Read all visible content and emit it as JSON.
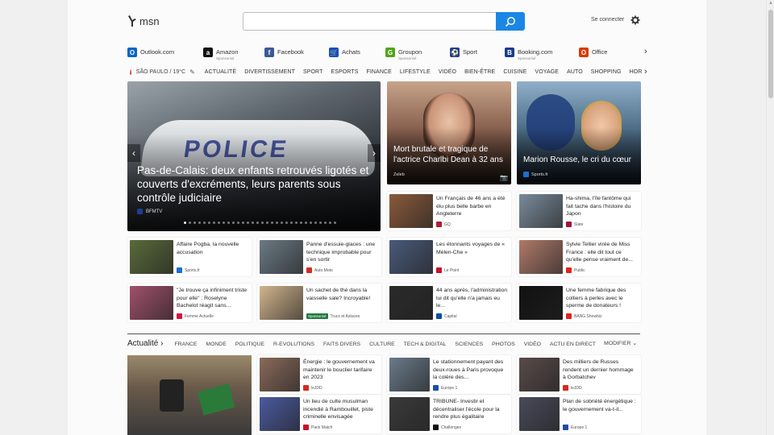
{
  "header": {
    "logo_text": "msn",
    "search_placeholder": "",
    "signin": "Se connecter"
  },
  "quick_links": [
    {
      "label": "Outlook.com",
      "sponsored": "",
      "color": "#0a64c8",
      "glyph": "O"
    },
    {
      "label": "Amazon",
      "sponsored": "Sponsorisé",
      "color": "#111111",
      "glyph": "a"
    },
    {
      "label": "Facebook",
      "sponsored": "",
      "color": "#3b5998",
      "glyph": "f"
    },
    {
      "label": "Achats",
      "sponsored": "",
      "color": "#1a4fb4",
      "glyph": "🛒"
    },
    {
      "label": "Groupon",
      "sponsored": "Sponsorisé",
      "color": "#53a318",
      "glyph": "G"
    },
    {
      "label": "Sport",
      "sponsored": "",
      "color": "#1f3f8f",
      "glyph": "⚽"
    },
    {
      "label": "Booking.com",
      "sponsored": "Sponsorisé",
      "color": "#1b3b8b",
      "glyph": "B"
    },
    {
      "label": "Office",
      "sponsored": "",
      "color": "#d83b01",
      "glyph": "O"
    }
  ],
  "navbar": {
    "alert": "!",
    "weather": "SÃO PAULO / 19°C",
    "categories": [
      "ACTUALITÉ",
      "DIVERTISSEMENT",
      "SPORT",
      "ESPORTS",
      "FINANCE",
      "LIFESTYLE",
      "VIDÉO",
      "BIEN-ÊTRE",
      "CUISINE",
      "VOYAGE",
      "AUTO",
      "SHOPPING",
      "HOROSCO"
    ]
  },
  "hero": {
    "title": "Pas-de-Calais: deux enfants retrouvés ligotés et couverts d'excréments, leurs parents sous contrôle judiciaire",
    "source": "BFMTV",
    "slide_count": 32,
    "active_slide": 0
  },
  "tiles": [
    {
      "title": "Mort brutale et tragique de l'actrice Charlbi Dean à 32 ans",
      "source": "Zeleb"
    },
    {
      "title": "Marion Rousse, le cri du cœur",
      "source": "Sports.fr"
    }
  ],
  "cards": [
    {
      "title": "Un Français de 46 ans a été élu plus belle barbe en Angleterre",
      "source": "GQ",
      "sponsored": "",
      "color": "#8a5a3a",
      "src_color": "#b01e2e"
    },
    {
      "title": "Ha-shima, l'île fantôme qui fait tache dans l'histoire du Japon",
      "source": "Slate",
      "sponsored": "",
      "color": "#7a8b9a",
      "src_color": "#a0143c"
    },
    {
      "title": "Affaire Pogba, la nouvelle accusation",
      "source": "Sports.fr",
      "sponsored": "",
      "color": "#5a6b3a",
      "src_color": "#1c6fd1"
    },
    {
      "title": "Panne d'essuie-glaces : une technique improbable pour s'en sortir",
      "source": "Auto Moto",
      "sponsored": "",
      "color": "#6b7a84",
      "src_color": "#d52b1e"
    },
    {
      "title": "Les étonnants voyages de « Mélen-Che »",
      "source": "Le Point",
      "sponsored": "",
      "color": "#4a5a7a",
      "src_color": "#c8102e"
    },
    {
      "title": "Sylvie Tellier virée de Miss France : elle dit tout ce qu'elle pense vraiment de...",
      "source": "Public",
      "sponsored": "",
      "color": "#b07a6a",
      "src_color": "#e2231a"
    },
    {
      "title": "\"Je trouve ça infiniment triste pour elle\" : Roselyne Bachelot réagit sans...",
      "source": "Femme Actuelle",
      "sponsored": "",
      "color": "#a0506a",
      "src_color": "#d6143c"
    },
    {
      "title": "Un sachet de thé dans la vaisselle sale? Incroyable!",
      "source": "Trucs et Astuces",
      "sponsored": "Sponsorisé",
      "color": "#d2b48c",
      "src_color": "#999999"
    },
    {
      "title": "44 ans après, l'administration lui dit qu'elle n'a jamais eu le...",
      "source": "Capital",
      "sponsored": "",
      "color": "#2a2a2a",
      "src_color": "#0a4da0"
    },
    {
      "title": "Une femme fabrique des colliers à perles avec le sperme de donateurs !",
      "source": "BANG Showbiz",
      "sponsored": "",
      "color": "#111111",
      "src_color": "#e2231a"
    }
  ],
  "section": {
    "title": "Actualité",
    "tabs": [
      "FRANCE",
      "MONDE",
      "POLITIQUE",
      "R-EVOLUTIONS",
      "FAITS DIVERS",
      "CULTURE",
      "TECH & DIGITAL",
      "SCIENCES",
      "PHOTOS",
      "VIDÉO",
      "ACTU EN DIRECT"
    ],
    "modify": "MODIFIER"
  },
  "news": [
    {
      "title": "Énergie : le gouvernement va maintenir le bouclier tarifaire en 2023",
      "source": "leJDD",
      "color": "#8a6a5a",
      "src_color": "#d52b1e"
    },
    {
      "title": "Le stationnement payant des deux-roues à Paris provoque la colère des...",
      "source": "Europe 1",
      "color": "#6a7a8a",
      "src_color": "#1c4fa0"
    },
    {
      "title": "Des milliers de Russes rendent un dernier hommage à Gorbatchev",
      "source": "leJDD",
      "color": "#5a4a4a",
      "src_color": "#d52b1e"
    },
    {
      "title": "Un lieu de culte musulman incendié à Rambouillet, piste criminelle envisagée",
      "source": "Paris Match",
      "color": "#4a5aa0",
      "src_color": "#c8102e"
    },
    {
      "title": "TRIBUNE- Investir et décentraliser l'école pour la rendre plus égalitaire",
      "source": "Challenges",
      "color": "#3a3a3a",
      "src_color": "#111111"
    },
    {
      "title": "Plan de sobriété énergétique : le gouvernement va-t-il...",
      "source": "Europe 1",
      "color": "#4a4a5a",
      "src_color": "#1c4fa0"
    }
  ]
}
